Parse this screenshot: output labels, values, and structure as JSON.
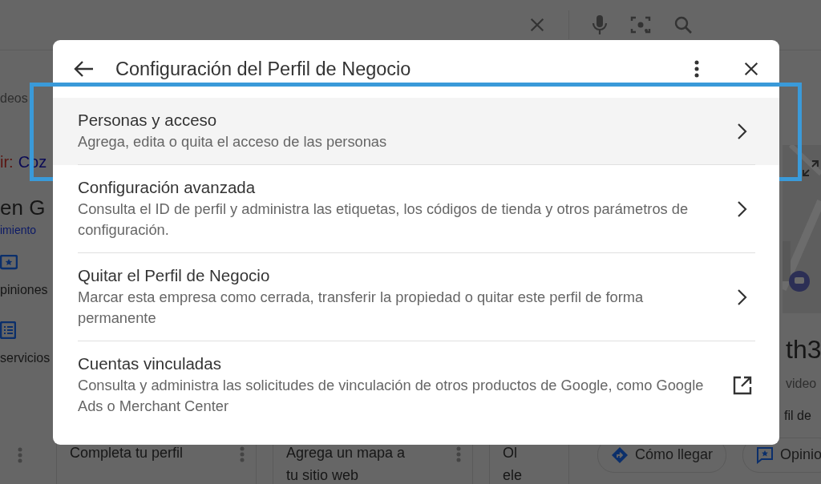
{
  "background": {
    "left_column": [
      {
        "kind": "text",
        "text": "deos"
      },
      {
        "kind": "suggestion",
        "label": "ir:",
        "value": "Coz"
      },
      {
        "kind": "heading",
        "text": "en G"
      },
      {
        "kind": "link",
        "text": "imiento"
      },
      {
        "kind": "action",
        "text": "piniones"
      },
      {
        "kind": "action",
        "text": "servicios"
      }
    ],
    "cards": [
      {
        "lines": [
          "Completa tu perfil"
        ]
      },
      {
        "lines": [
          "Agrega un mapa a",
          "tu sitio web"
        ]
      },
      {
        "lines": [
          "Ol",
          "ele"
        ]
      }
    ],
    "chips": [
      {
        "label": "Cómo llegar"
      },
      {
        "label": "Opinio"
      }
    ],
    "right_panel": {
      "title": "th3",
      "line_1": "video",
      "line_2": "fil de"
    }
  },
  "dialog": {
    "title": "Configuración del Perfil de Negocio",
    "rows": [
      {
        "title": "Personas y acceso",
        "subtitle": "Agrega, edita o quita el acceso de las personas",
        "kind": "page",
        "selected": true,
        "highlighted": true
      },
      {
        "title": "Configuración avanzada",
        "subtitle": "Consulta el ID de perfil y administra las etiquetas, los códigos de tienda y otros parámetros de configuración.",
        "kind": "page",
        "selected": false,
        "highlighted": false
      },
      {
        "title": "Quitar el Perfil de Negocio",
        "subtitle": "Marcar esta empresa como cerrada, transferir la propiedad o quitar este perfil de forma permanente",
        "kind": "page",
        "selected": false,
        "highlighted": false
      },
      {
        "title": "Cuentas vinculadas",
        "subtitle": "Consulta y administra las solicitudes de vinculación de otros productos de Google, como Google Ads o Merchant Center",
        "kind": "external",
        "selected": false,
        "highlighted": false
      }
    ]
  }
}
